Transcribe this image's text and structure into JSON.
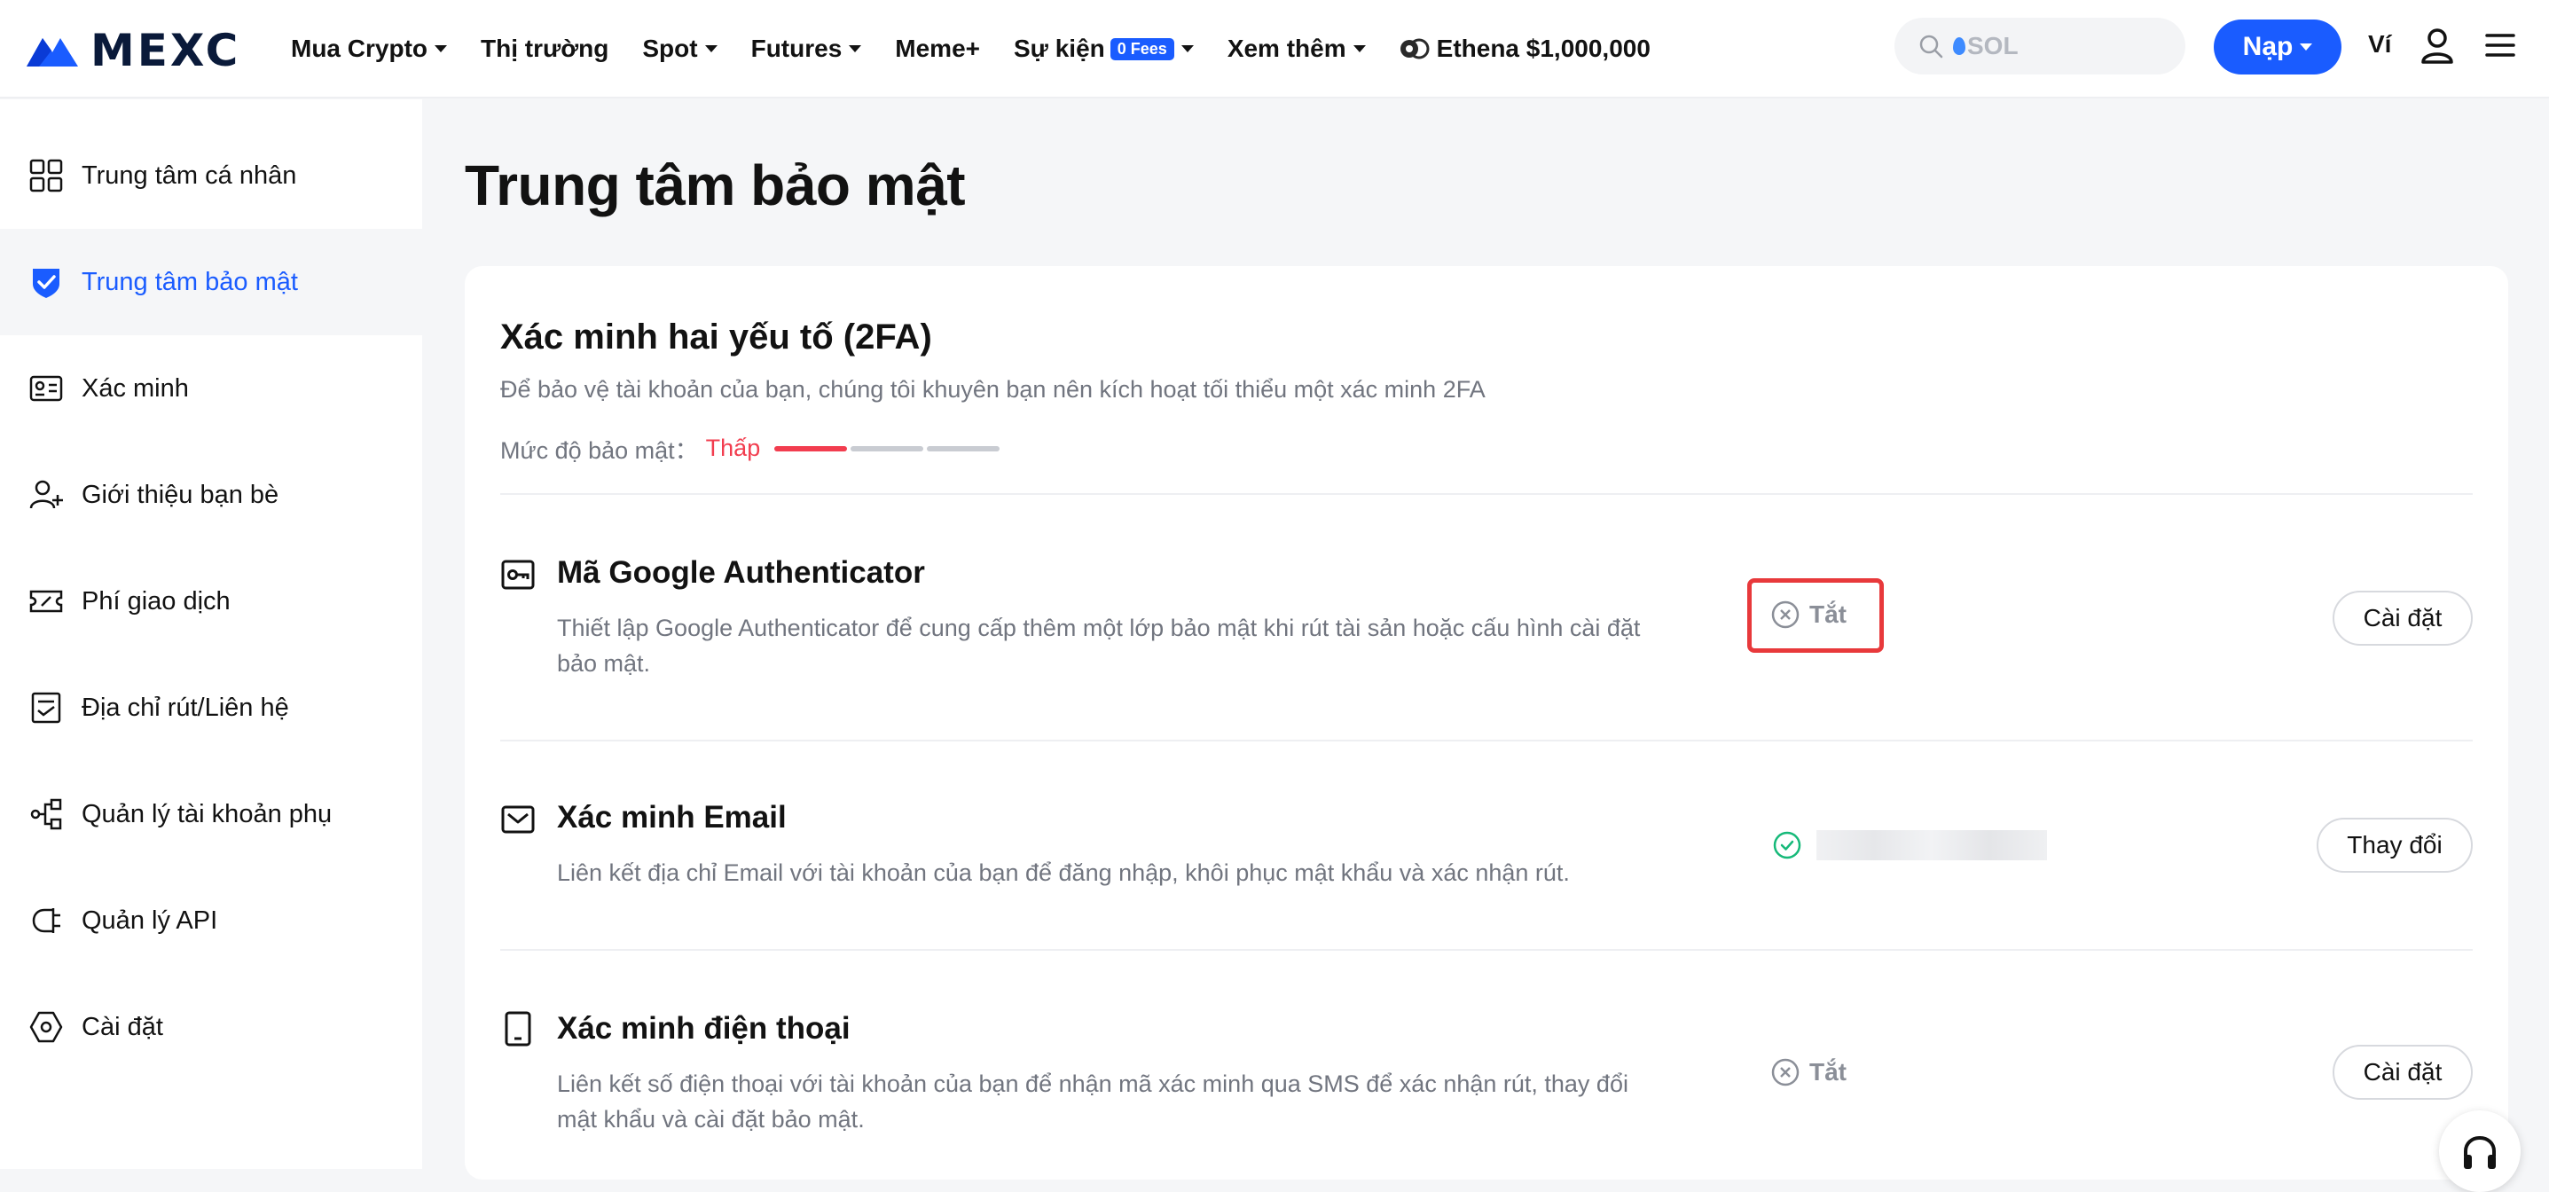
{
  "brand": {
    "name": "MEXC"
  },
  "nav": {
    "items": [
      {
        "label": "Mua Crypto",
        "dropdown": true
      },
      {
        "label": "Thị trường",
        "dropdown": false
      },
      {
        "label": "Spot",
        "dropdown": true
      },
      {
        "label": "Futures",
        "dropdown": true
      },
      {
        "label": "Meme+",
        "dropdown": false
      },
      {
        "label": "Sự kiện",
        "dropdown": true,
        "badge": "0 Fees"
      },
      {
        "label": "Xem thêm",
        "dropdown": true
      }
    ],
    "promo": {
      "label": "Ethena $1,000,000",
      "icon": "ethena-icon"
    }
  },
  "search": {
    "placeholder": "SOL",
    "icon": "search-icon"
  },
  "header_actions": {
    "deposit_label": "Nạp",
    "wallet_label": "Ví"
  },
  "sidebar": {
    "items": [
      {
        "label": "Trung tâm cá nhân",
        "icon": "dashboard-icon",
        "active": false
      },
      {
        "label": "Trung tâm bảo mật",
        "icon": "shield-icon",
        "active": true
      },
      {
        "label": "Xác minh",
        "icon": "id-card-icon",
        "active": false
      },
      {
        "label": "Giới thiệu bạn bè",
        "icon": "user-add-icon",
        "active": false
      },
      {
        "label": "Phí giao dịch",
        "icon": "fee-ticket-icon",
        "active": false
      },
      {
        "label": "Địa chỉ rút/Liên hệ",
        "icon": "address-book-icon",
        "active": false
      },
      {
        "label": "Quản lý tài khoản phụ",
        "icon": "sub-account-icon",
        "active": false
      },
      {
        "label": "Quản lý API",
        "icon": "api-plug-icon",
        "active": false
      },
      {
        "label": "Cài đặt",
        "icon": "settings-hex-icon",
        "active": false
      }
    ]
  },
  "page": {
    "title": "Trung tâm bảo mật"
  },
  "twofa": {
    "title": "Xác minh hai yếu tố (2FA)",
    "description": "Để bảo vệ tài khoản của bạn, chúng tôi khuyên bạn nên kích hoạt tối thiểu một xác minh 2FA",
    "level_label": "Mức độ bảo mật：",
    "level_value": "Thấp",
    "level_filled": 1,
    "level_total": 3,
    "colors": {
      "accent": "#1a5cff",
      "danger": "#f23d4f",
      "success": "#16b979"
    },
    "methods": [
      {
        "title": "Mã Google Authenticator",
        "icon": "key-icon",
        "description": "Thiết lập Google Authenticator để cung cấp thêm một lớp bảo mật khi rút tài sản hoặc cấu hình cài đặt bảo mật.",
        "status": "Tắt",
        "status_icon": "circle-x-icon",
        "action": "Cài đặt"
      },
      {
        "title": "Xác minh Email",
        "icon": "mail-icon",
        "description": "Liên kết địa chỉ Email với tài khoản của bạn để đăng nhập, khôi phục mật khẩu và xác nhận rút.",
        "status": "",
        "status_icon": "circle-check-icon",
        "action": "Thay đổi"
      },
      {
        "title": "Xác minh điện thoại",
        "icon": "phone-icon",
        "description": "Liên kết số điện thoại với tài khoản của bạn để nhận mã xác minh qua SMS để xác nhận rút, thay đổi mật khẩu và cài đặt bảo mật.",
        "status": "Tắt",
        "status_icon": "circle-x-icon",
        "action": "Cài đặt"
      }
    ]
  }
}
